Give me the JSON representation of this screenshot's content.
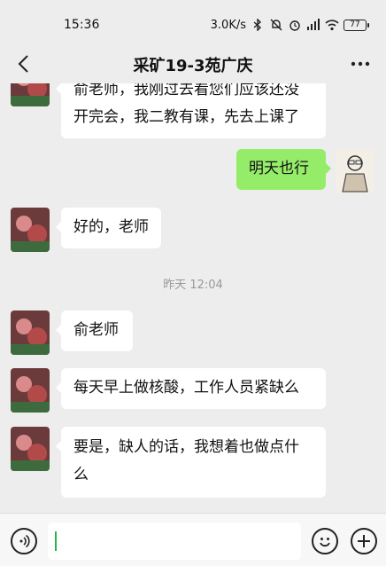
{
  "status_bar": {
    "time": "15:36",
    "speed": "3.0K/s",
    "battery": "77"
  },
  "nav": {
    "title": "采矿19-3苑广庆"
  },
  "messages": [
    {
      "side": "left",
      "line1": "俞老师，我刚过去看您们应该还没",
      "line2": "开完会，我二教有课，先去上课了"
    },
    {
      "side": "right",
      "text": "明天也行"
    },
    {
      "side": "left",
      "text": "好的，老师"
    },
    {
      "side": "left",
      "text": "俞老师"
    },
    {
      "side": "left",
      "text": "每天早上做核酸，工作人员紧缺么"
    },
    {
      "side": "left",
      "line1": "要是，缺人的话，我想着也做点什",
      "line2": "么"
    }
  ],
  "timestamp": "昨天 12:04",
  "colors": {
    "background": "#ededed",
    "self_bubble": "#95ec69",
    "other_bubble": "#ffffff",
    "caret": "#2bb24c"
  },
  "icons": [
    "back-icon",
    "more-icon",
    "voice-icon",
    "emoji-icon",
    "plus-icon",
    "bluetooth-icon",
    "mute-bell-icon",
    "alarm-icon",
    "signal-icon",
    "wifi-icon",
    "battery-icon"
  ]
}
